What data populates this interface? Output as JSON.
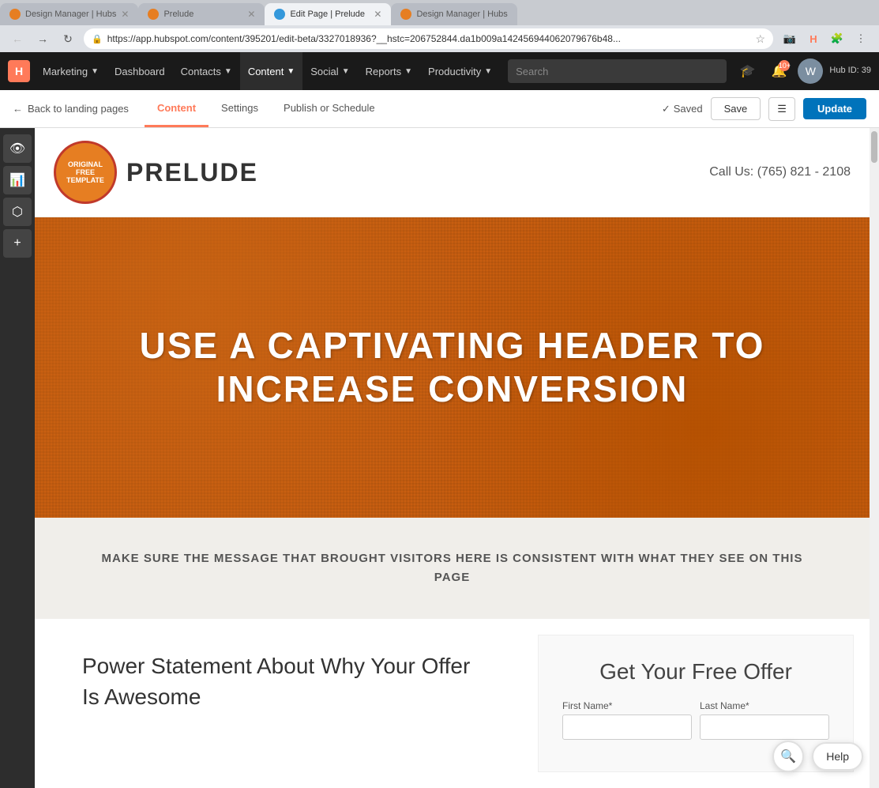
{
  "browser": {
    "tabs": [
      {
        "id": "tab1",
        "title": "Design Manager | Hubs",
        "favicon": "orange",
        "active": false
      },
      {
        "id": "tab2",
        "title": "Prelude",
        "favicon": "orange",
        "active": false
      },
      {
        "id": "tab3",
        "title": "Edit Page | Prelude",
        "favicon": "blue",
        "active": true
      },
      {
        "id": "tab4",
        "title": "Design Manager | Hubs",
        "favicon": "orange",
        "active": false
      }
    ],
    "url": "https://app.hubspot.com/content/395201/edit-beta/3327018936?__hstc=206752844.da1b009a142456944062079676b48...",
    "secure_label": "Secure"
  },
  "nav": {
    "logo_text": "H",
    "items": [
      {
        "label": "Marketing",
        "dropdown": true,
        "active": false
      },
      {
        "label": "Dashboard",
        "dropdown": false,
        "active": false
      },
      {
        "label": "Contacts",
        "dropdown": true,
        "active": false
      },
      {
        "label": "Content",
        "dropdown": true,
        "active": true
      },
      {
        "label": "Social",
        "dropdown": true,
        "active": false
      },
      {
        "label": "Reports",
        "dropdown": true,
        "active": false
      },
      {
        "label": "Productivity",
        "dropdown": true,
        "active": false
      }
    ],
    "search_placeholder": "Search",
    "notification_count": "10+",
    "user": {
      "initials": "W",
      "hub_id": "Hub ID: 39"
    }
  },
  "toolbar": {
    "back_label": "Back to landing pages",
    "tabs": [
      {
        "label": "Content",
        "active": true
      },
      {
        "label": "Settings",
        "active": false
      },
      {
        "label": "Publish or Schedule",
        "active": false
      }
    ],
    "saved_label": "Saved",
    "save_label": "Save",
    "update_label": "Update"
  },
  "sidebar": {
    "buttons": [
      {
        "icon": "👁",
        "name": "preview-icon"
      },
      {
        "icon": "📊",
        "name": "stats-icon"
      },
      {
        "icon": "⬡",
        "name": "modules-icon"
      },
      {
        "icon": "+",
        "name": "add-icon"
      }
    ]
  },
  "page": {
    "brand": "PRELUDE",
    "logo_text_top": "ORIGINAL FREE TEMPLATE",
    "phone": "Call Us: (765) 821 - 2108",
    "hero_title_line1": "USE A CAPTIVATING HEADER TO",
    "hero_title_line2": "INCREASE CONVERSION",
    "sub_hero_text": "MAKE SURE THE MESSAGE THAT BROUGHT VISITORS HERE IS CONSISTENT WITH WHAT THEY SEE ON THIS PAGE",
    "power_statement": "Power Statement About Why Your Offer Is Awesome",
    "form": {
      "title": "Get Your Free Offer",
      "first_name_label": "First Name*",
      "last_name_label": "Last Name*"
    }
  },
  "help": {
    "search_icon": "🔍",
    "help_label": "Help"
  }
}
